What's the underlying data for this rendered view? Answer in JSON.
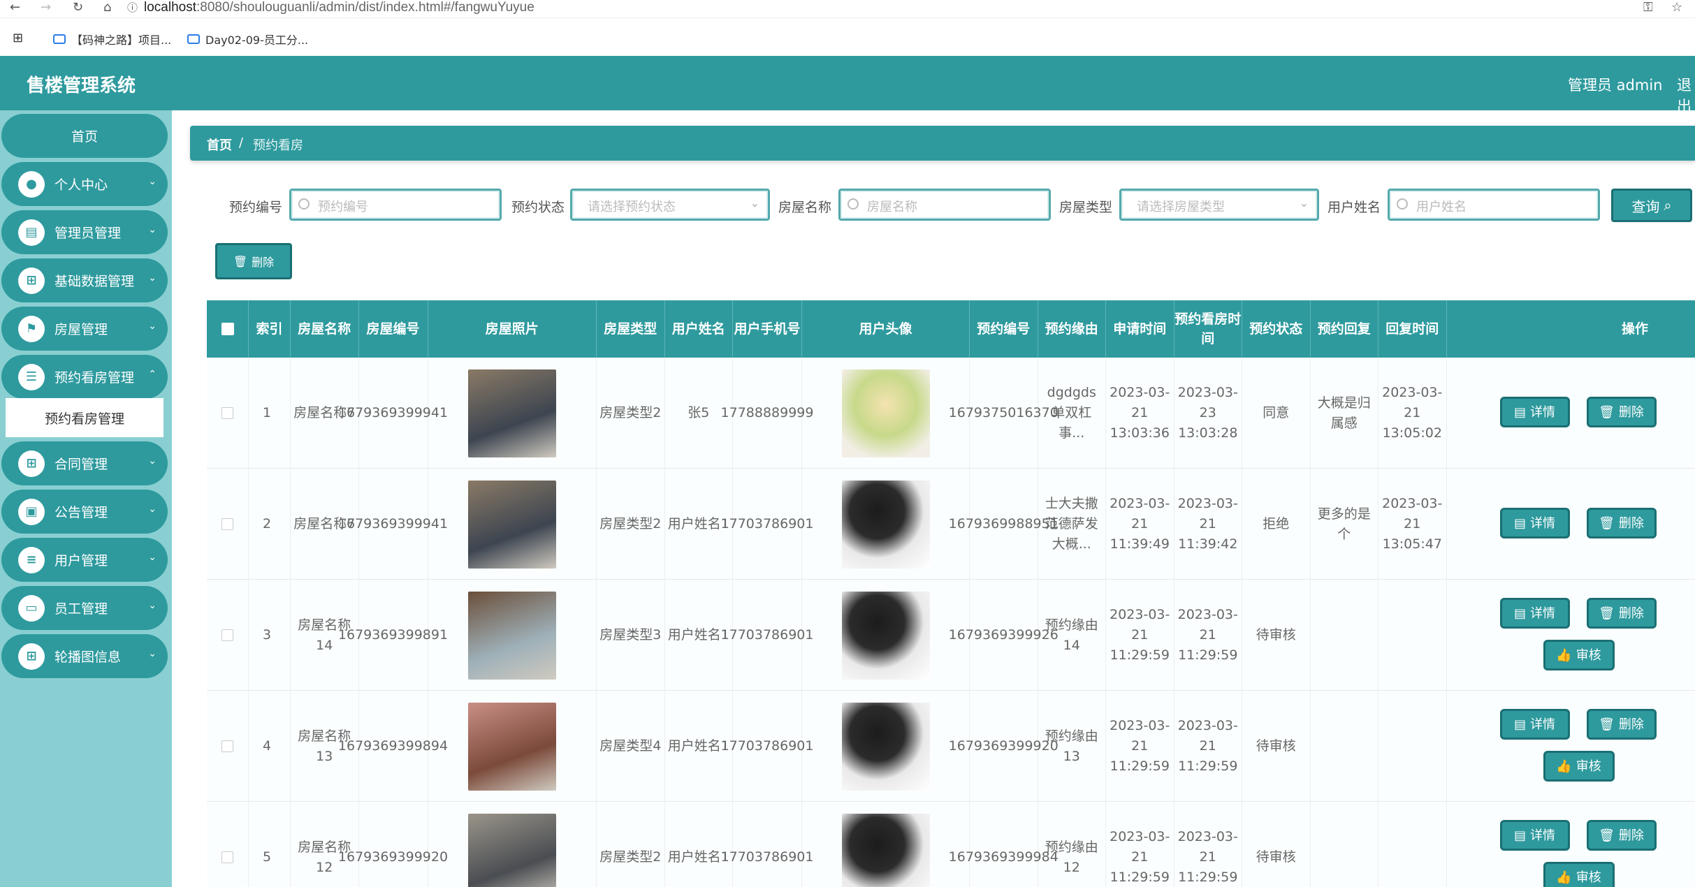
{
  "browser": {
    "url_host": "localhost",
    "url_rest": ":8080/shoulouguanli/admin/dist/index.html#/fangwuYuyue",
    "bookmarks": [
      "【码神之路】项目...",
      "Day02-09-员工分..."
    ]
  },
  "header": {
    "title": "售楼管理系统",
    "user": "管理员 admin",
    "exit": "退出"
  },
  "sidebar": {
    "home": "首页",
    "items": [
      {
        "label": "个人中心",
        "icon": "user-icon"
      },
      {
        "label": "管理员管理",
        "icon": "clipboard-icon"
      },
      {
        "label": "基础数据管理",
        "icon": "grid-icon"
      },
      {
        "label": "房屋管理",
        "icon": "flag-icon"
      },
      {
        "label": "预约看房管理",
        "icon": "sliders-icon"
      },
      {
        "label": "合同管理",
        "icon": "grid-icon"
      },
      {
        "label": "公告管理",
        "icon": "podium-icon"
      },
      {
        "label": "用户管理",
        "icon": "list-icon"
      },
      {
        "label": "员工管理",
        "icon": "monitor-icon"
      },
      {
        "label": "轮播图信息",
        "icon": "grid-icon"
      }
    ],
    "active_sub": "预约看房管理"
  },
  "breadcrumb": {
    "home": "首页",
    "sep": "/",
    "current": "预约看房"
  },
  "search": {
    "fields": [
      {
        "label": "预约编号",
        "placeholder": "预约编号"
      },
      {
        "label": "预约状态",
        "placeholder": "请选择预约状态"
      },
      {
        "label": "房屋名称",
        "placeholder": "房屋名称"
      },
      {
        "label": "房屋类型",
        "placeholder": "请选择房屋类型"
      },
      {
        "label": "用户姓名",
        "placeholder": "用户姓名"
      }
    ],
    "query": "查询",
    "delete": "删除"
  },
  "table": {
    "headers": [
      "索引",
      "房屋名称",
      "房屋编号",
      "房屋照片",
      "房屋类型",
      "用户姓名",
      "用户手机号",
      "用户头像",
      "预约编号",
      "预约缘由",
      "申请时间",
      "预约看房时间",
      "预约状态",
      "预约回复",
      "回复时间",
      "操作"
    ],
    "buttons": {
      "detail": "详情",
      "delete": "删除",
      "audit": "审核"
    },
    "rows": [
      {
        "idx": "1",
        "name": "房屋名称7",
        "no": "1679369399941",
        "type": "房屋类型2",
        "user": "张5",
        "phone": "17788889999",
        "yno": "1679375016370",
        "reason": "dgdgds单双杠事...",
        "apply": "2023-03-21 13:03:36",
        "visit": "2023-03-23 13:03:28",
        "status": "同意",
        "reply": "大概是归属感",
        "rtime": "2023-03-21 13:05:02",
        "audit": false
      },
      {
        "idx": "2",
        "name": "房屋名称7",
        "no": "1679369399941",
        "type": "房屋类型2",
        "user": "用户姓名1",
        "phone": "17703786901",
        "yno": "1679369988951",
        "reason": "士大夫撒范德萨发大概...",
        "apply": "2023-03-21 11:39:49",
        "visit": "2023-03-21 11:39:42",
        "status": "拒绝",
        "reply": "更多的是个",
        "rtime": "2023-03-21 13:05:47",
        "audit": false
      },
      {
        "idx": "3",
        "name": "房屋名称14",
        "no": "1679369399891",
        "type": "房屋类型3",
        "user": "用户姓名1",
        "phone": "17703786901",
        "yno": "1679369399926",
        "reason": "预约缘由14",
        "apply": "2023-03-21 11:29:59",
        "visit": "2023-03-21 11:29:59",
        "status": "待审核",
        "reply": "",
        "rtime": "",
        "audit": true
      },
      {
        "idx": "4",
        "name": "房屋名称13",
        "no": "1679369399894",
        "type": "房屋类型4",
        "user": "用户姓名1",
        "phone": "17703786901",
        "yno": "1679369399920",
        "reason": "预约缘由13",
        "apply": "2023-03-21 11:29:59",
        "visit": "2023-03-21 11:29:59",
        "status": "待审核",
        "reply": "",
        "rtime": "",
        "audit": true
      },
      {
        "idx": "5",
        "name": "房屋名称12",
        "no": "1679369399920",
        "type": "房屋类型2",
        "user": "用户姓名1",
        "phone": "17703786901",
        "yno": "1679369399984",
        "reason": "预约缘由12",
        "apply": "2023-03-21 11:29:59",
        "visit": "2023-03-21 11:29:59",
        "status": "待审核",
        "reply": "",
        "rtime": "",
        "audit": true
      }
    ]
  }
}
